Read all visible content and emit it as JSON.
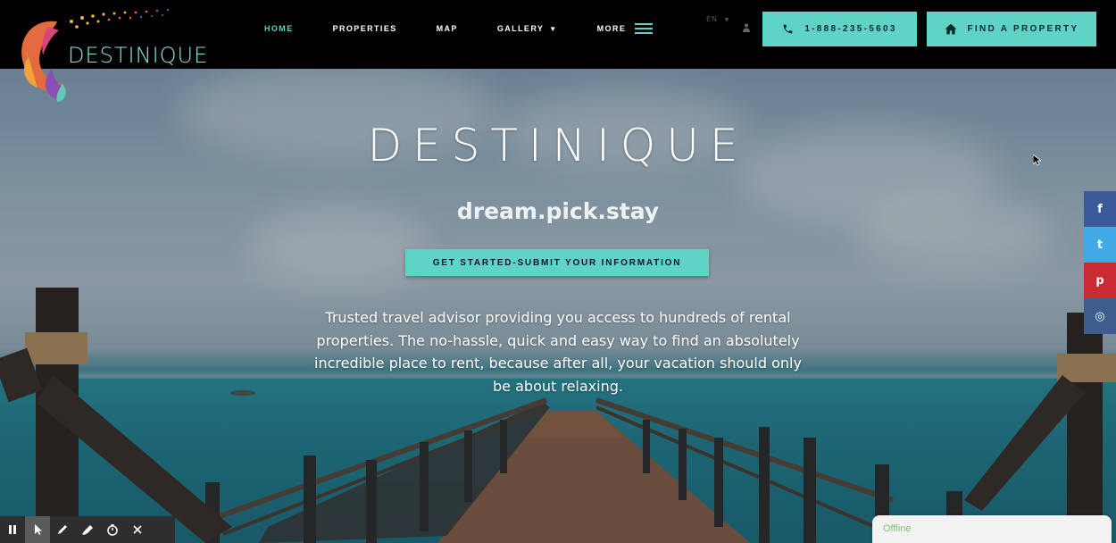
{
  "brand": {
    "logo_text": "DESTINIQUE"
  },
  "nav": {
    "items": [
      {
        "label": "HOME",
        "active": true
      },
      {
        "label": "PROPERTIES",
        "active": false
      },
      {
        "label": "MAP",
        "active": false
      },
      {
        "label": "GALLERY",
        "active": false,
        "dropdown": true
      },
      {
        "label": "MORE",
        "active": false,
        "menu_icon": "hamburger-icon"
      }
    ],
    "language": "EN",
    "phone_button": "1-888-235-5603",
    "find_button": "FIND A PROPERTY"
  },
  "hero": {
    "title": "DESTINIQUE",
    "tagline": "dream.pick.stay",
    "cta_label": "GET STARTED-SUBMIT YOUR INFORMATION",
    "description": "Trusted travel advisor providing you access to hundreds of rental properties. The no-hassle, quick and easy way to find an absolutely incredible place to rent, because after all, your vacation should only be about relaxing."
  },
  "social": [
    {
      "name": "facebook-icon",
      "glyph": "f",
      "color": "#3c5a99"
    },
    {
      "name": "twitter-icon",
      "glyph": "t",
      "color": "#41a9e6"
    },
    {
      "name": "pinterest-icon",
      "glyph": "p",
      "color": "#c92a33"
    },
    {
      "name": "instagram-icon",
      "glyph": "◎",
      "color": "#3c5d8e"
    }
  ],
  "chat": {
    "status": "Offline"
  },
  "colors": {
    "accent": "#5fd3c5",
    "nav_bg": "#000000"
  },
  "recorder_toolbar": {
    "tools": [
      "pause-icon",
      "pointer-icon",
      "pen-icon",
      "highlighter-icon",
      "timer-icon",
      "close-icon"
    ]
  }
}
